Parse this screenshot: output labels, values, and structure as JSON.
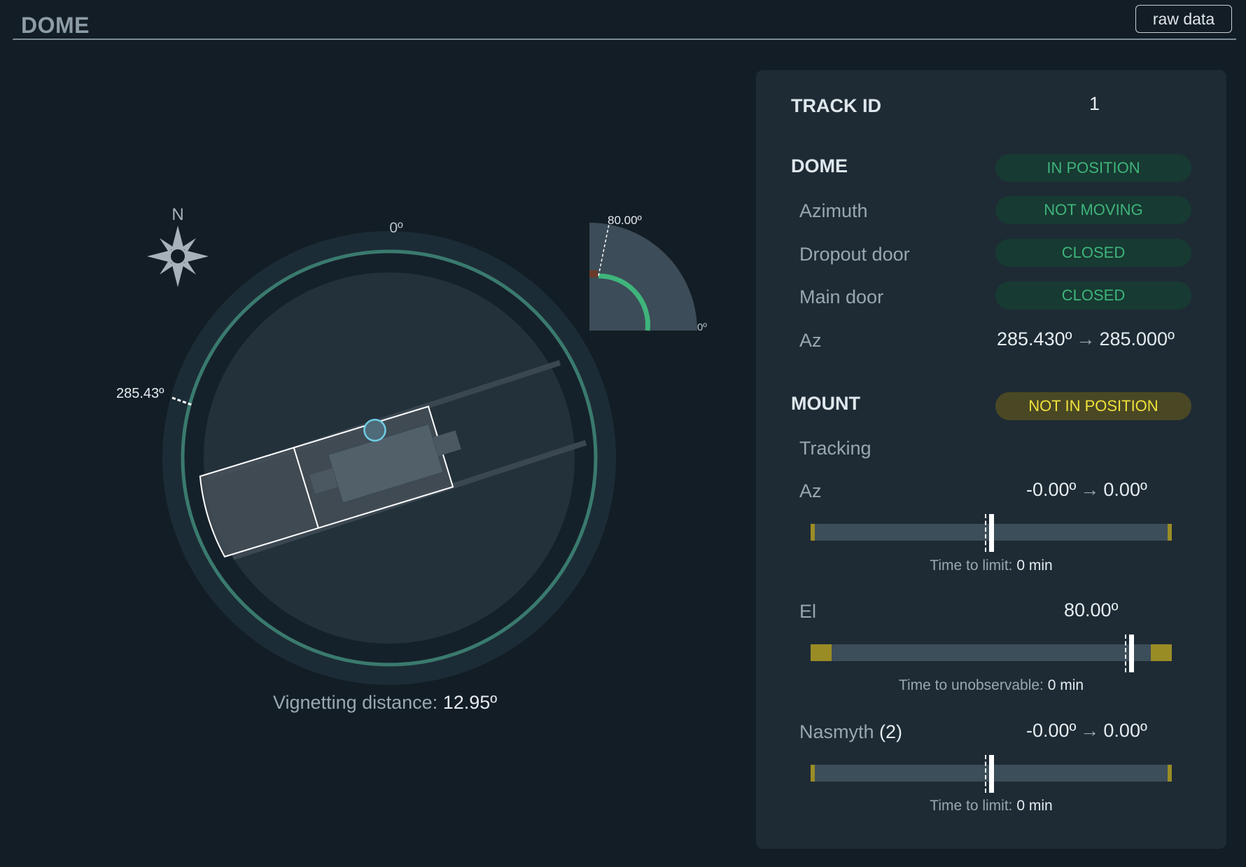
{
  "header": {
    "title": "DOME",
    "raw_data_label": "raw data"
  },
  "dome_view": {
    "north_label": "N",
    "top_angle_label": "0º",
    "azimuth_marker_label": "285.43º",
    "elevation_gauge": {
      "max_label": "80.00º",
      "min_label": "0º"
    },
    "vignetting": {
      "label": "Vignetting distance:",
      "value": "12.95º"
    }
  },
  "panel": {
    "track_id": {
      "label": "TRACK ID",
      "value": "1"
    },
    "dome": {
      "label": "DOME",
      "status": "IN POSITION",
      "azimuth": {
        "label": "Azimuth",
        "status": "NOT MOVING"
      },
      "dropout_door": {
        "label": "Dropout door",
        "status": "CLOSED"
      },
      "main_door": {
        "label": "Main door",
        "status": "CLOSED"
      },
      "az": {
        "label": "Az",
        "current": "285.430º",
        "target": "285.000º"
      }
    },
    "mount": {
      "label": "MOUNT",
      "status": "NOT IN POSITION",
      "tracking_label": "Tracking",
      "az": {
        "label": "Az",
        "current": "-0.00º",
        "target": "0.00º",
        "time_label": "Time to limit:",
        "time_value": "0 min",
        "position_fraction": 0.5
      },
      "el": {
        "label": "El",
        "current": "80.00º",
        "time_label": "Time to unobservable:",
        "time_value": "0 min",
        "position_fraction": 0.887
      },
      "nasmyth": {
        "label": "Nasmyth",
        "index": "(2)",
        "current": "-0.00º",
        "target": "0.00º",
        "time_label": "Time to limit:",
        "time_value": "0 min",
        "position_fraction": 0.5
      }
    }
  },
  "colors": {
    "ok_text": "#3fb47b",
    "ok_bg": "#173a32",
    "warn_text": "#f0e13c",
    "warn_bg": "#4a4824",
    "limit": "#9a8c25"
  }
}
